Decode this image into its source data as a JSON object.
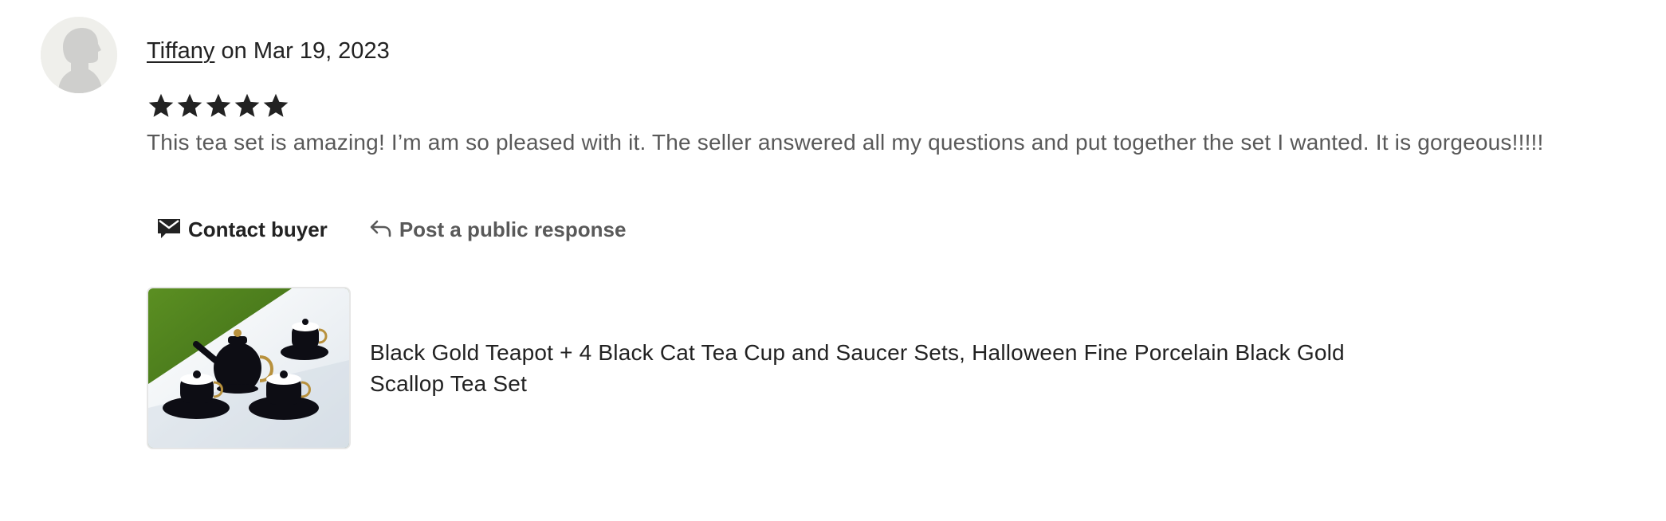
{
  "review": {
    "reviewer_name": "Tiffany",
    "date_prefix": " on ",
    "date": "Mar 19, 2023",
    "rating": 5,
    "rating_max": 5,
    "text": "This tea set is amazing! I’m am so pleased with it. The seller answered all my questions and put together the set I wanted. It is gorgeous!!!!!"
  },
  "actions": {
    "contact_label": "Contact buyer",
    "contact_icon": "envelope-icon",
    "respond_label": "Post a public response",
    "respond_icon": "reply-arrow-icon"
  },
  "listing": {
    "title": "Black Gold Teapot + 4 Black Cat Tea Cup and Saucer Sets, Halloween Fine Porcelain Black Gold Scallop Tea Set"
  },
  "colors": {
    "text_primary": "#222222",
    "text_secondary": "#595959",
    "avatar_bg": "#efefeb"
  }
}
